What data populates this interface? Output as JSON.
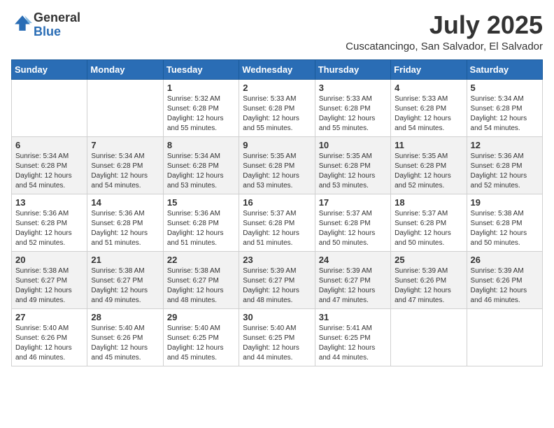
{
  "logo": {
    "general": "General",
    "blue": "Blue"
  },
  "title": {
    "month_year": "July 2025",
    "location": "Cuscatancingo, San Salvador, El Salvador"
  },
  "headers": [
    "Sunday",
    "Monday",
    "Tuesday",
    "Wednesday",
    "Thursday",
    "Friday",
    "Saturday"
  ],
  "weeks": [
    [
      {
        "day": "",
        "info": ""
      },
      {
        "day": "",
        "info": ""
      },
      {
        "day": "1",
        "info": "Sunrise: 5:32 AM\nSunset: 6:28 PM\nDaylight: 12 hours and 55 minutes."
      },
      {
        "day": "2",
        "info": "Sunrise: 5:33 AM\nSunset: 6:28 PM\nDaylight: 12 hours and 55 minutes."
      },
      {
        "day": "3",
        "info": "Sunrise: 5:33 AM\nSunset: 6:28 PM\nDaylight: 12 hours and 55 minutes."
      },
      {
        "day": "4",
        "info": "Sunrise: 5:33 AM\nSunset: 6:28 PM\nDaylight: 12 hours and 54 minutes."
      },
      {
        "day": "5",
        "info": "Sunrise: 5:34 AM\nSunset: 6:28 PM\nDaylight: 12 hours and 54 minutes."
      }
    ],
    [
      {
        "day": "6",
        "info": "Sunrise: 5:34 AM\nSunset: 6:28 PM\nDaylight: 12 hours and 54 minutes."
      },
      {
        "day": "7",
        "info": "Sunrise: 5:34 AM\nSunset: 6:28 PM\nDaylight: 12 hours and 54 minutes."
      },
      {
        "day": "8",
        "info": "Sunrise: 5:34 AM\nSunset: 6:28 PM\nDaylight: 12 hours and 53 minutes."
      },
      {
        "day": "9",
        "info": "Sunrise: 5:35 AM\nSunset: 6:28 PM\nDaylight: 12 hours and 53 minutes."
      },
      {
        "day": "10",
        "info": "Sunrise: 5:35 AM\nSunset: 6:28 PM\nDaylight: 12 hours and 53 minutes."
      },
      {
        "day": "11",
        "info": "Sunrise: 5:35 AM\nSunset: 6:28 PM\nDaylight: 12 hours and 52 minutes."
      },
      {
        "day": "12",
        "info": "Sunrise: 5:36 AM\nSunset: 6:28 PM\nDaylight: 12 hours and 52 minutes."
      }
    ],
    [
      {
        "day": "13",
        "info": "Sunrise: 5:36 AM\nSunset: 6:28 PM\nDaylight: 12 hours and 52 minutes."
      },
      {
        "day": "14",
        "info": "Sunrise: 5:36 AM\nSunset: 6:28 PM\nDaylight: 12 hours and 51 minutes."
      },
      {
        "day": "15",
        "info": "Sunrise: 5:36 AM\nSunset: 6:28 PM\nDaylight: 12 hours and 51 minutes."
      },
      {
        "day": "16",
        "info": "Sunrise: 5:37 AM\nSunset: 6:28 PM\nDaylight: 12 hours and 51 minutes."
      },
      {
        "day": "17",
        "info": "Sunrise: 5:37 AM\nSunset: 6:28 PM\nDaylight: 12 hours and 50 minutes."
      },
      {
        "day": "18",
        "info": "Sunrise: 5:37 AM\nSunset: 6:28 PM\nDaylight: 12 hours and 50 minutes."
      },
      {
        "day": "19",
        "info": "Sunrise: 5:38 AM\nSunset: 6:28 PM\nDaylight: 12 hours and 50 minutes."
      }
    ],
    [
      {
        "day": "20",
        "info": "Sunrise: 5:38 AM\nSunset: 6:27 PM\nDaylight: 12 hours and 49 minutes."
      },
      {
        "day": "21",
        "info": "Sunrise: 5:38 AM\nSunset: 6:27 PM\nDaylight: 12 hours and 49 minutes."
      },
      {
        "day": "22",
        "info": "Sunrise: 5:38 AM\nSunset: 6:27 PM\nDaylight: 12 hours and 48 minutes."
      },
      {
        "day": "23",
        "info": "Sunrise: 5:39 AM\nSunset: 6:27 PM\nDaylight: 12 hours and 48 minutes."
      },
      {
        "day": "24",
        "info": "Sunrise: 5:39 AM\nSunset: 6:27 PM\nDaylight: 12 hours and 47 minutes."
      },
      {
        "day": "25",
        "info": "Sunrise: 5:39 AM\nSunset: 6:26 PM\nDaylight: 12 hours and 47 minutes."
      },
      {
        "day": "26",
        "info": "Sunrise: 5:39 AM\nSunset: 6:26 PM\nDaylight: 12 hours and 46 minutes."
      }
    ],
    [
      {
        "day": "27",
        "info": "Sunrise: 5:40 AM\nSunset: 6:26 PM\nDaylight: 12 hours and 46 minutes."
      },
      {
        "day": "28",
        "info": "Sunrise: 5:40 AM\nSunset: 6:26 PM\nDaylight: 12 hours and 45 minutes."
      },
      {
        "day": "29",
        "info": "Sunrise: 5:40 AM\nSunset: 6:25 PM\nDaylight: 12 hours and 45 minutes."
      },
      {
        "day": "30",
        "info": "Sunrise: 5:40 AM\nSunset: 6:25 PM\nDaylight: 12 hours and 44 minutes."
      },
      {
        "day": "31",
        "info": "Sunrise: 5:41 AM\nSunset: 6:25 PM\nDaylight: 12 hours and 44 minutes."
      },
      {
        "day": "",
        "info": ""
      },
      {
        "day": "",
        "info": ""
      }
    ]
  ]
}
